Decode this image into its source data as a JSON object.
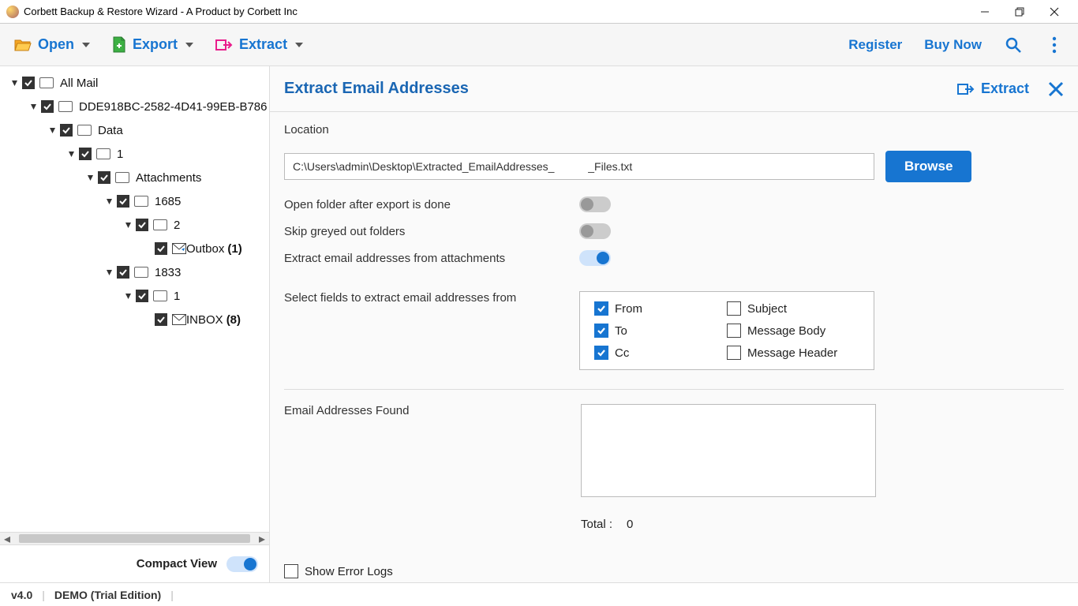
{
  "window": {
    "title": "Corbett Backup & Restore Wizard - A Product by Corbett Inc"
  },
  "toolbar": {
    "open": "Open",
    "export": "Export",
    "extract": "Extract",
    "register": "Register",
    "buy_now": "Buy Now"
  },
  "tree": {
    "nodes": [
      {
        "indent": 0,
        "checked": true,
        "expanded": true,
        "icon": "folder",
        "label": "All Mail",
        "count": null
      },
      {
        "indent": 1,
        "checked": true,
        "expanded": true,
        "icon": "folder",
        "label": "DDE918BC-2582-4D41-99EB-B786",
        "count": null
      },
      {
        "indent": 2,
        "checked": true,
        "expanded": true,
        "icon": "folder",
        "label": "Data",
        "count": null
      },
      {
        "indent": 3,
        "checked": true,
        "expanded": true,
        "icon": "folder",
        "label": "1",
        "count": null
      },
      {
        "indent": 4,
        "checked": true,
        "expanded": true,
        "icon": "folder",
        "label": "Attachments",
        "count": null
      },
      {
        "indent": 5,
        "checked": true,
        "expanded": true,
        "icon": "folder",
        "label": "1685",
        "count": null
      },
      {
        "indent": 6,
        "checked": true,
        "expanded": true,
        "icon": "folder",
        "label": "2",
        "count": null
      },
      {
        "indent": 7,
        "checked": true,
        "expanded": null,
        "icon": "outbox",
        "label": "Outbox",
        "count": "(1)"
      },
      {
        "indent": 5,
        "checked": true,
        "expanded": true,
        "icon": "folder",
        "label": "1833",
        "count": null
      },
      {
        "indent": 6,
        "checked": true,
        "expanded": true,
        "icon": "folder",
        "label": "1",
        "count": null
      },
      {
        "indent": 7,
        "checked": true,
        "expanded": null,
        "icon": "inbox",
        "label": "INBOX",
        "count": "(8)"
      }
    ],
    "compact_view_label": "Compact View",
    "compact_view_on": true
  },
  "panel": {
    "title": "Extract Email Addresses",
    "header_action": "Extract",
    "location_label": "Location",
    "location_value": "C:\\Users\\admin\\Desktop\\Extracted_EmailAddresses_           _Files.txt",
    "browse": "Browse",
    "options": [
      {
        "label": "Open folder after export is done",
        "on": false
      },
      {
        "label": "Skip greyed out folders",
        "on": false
      },
      {
        "label": "Extract email addresses from attachments",
        "on": true
      }
    ],
    "fields_label": "Select fields to extract email addresses from",
    "fields": [
      {
        "label": "From",
        "checked": true
      },
      {
        "label": "Subject",
        "checked": false
      },
      {
        "label": "To",
        "checked": true
      },
      {
        "label": "Message Body",
        "checked": false
      },
      {
        "label": "Cc",
        "checked": true
      },
      {
        "label": "Message Header",
        "checked": false
      }
    ],
    "found_label": "Email Addresses Found",
    "total_label": "Total :",
    "total_value": "0",
    "show_error_logs": "Show Error Logs"
  },
  "status": {
    "version": "v4.0",
    "edition": "DEMO (Trial Edition)"
  }
}
